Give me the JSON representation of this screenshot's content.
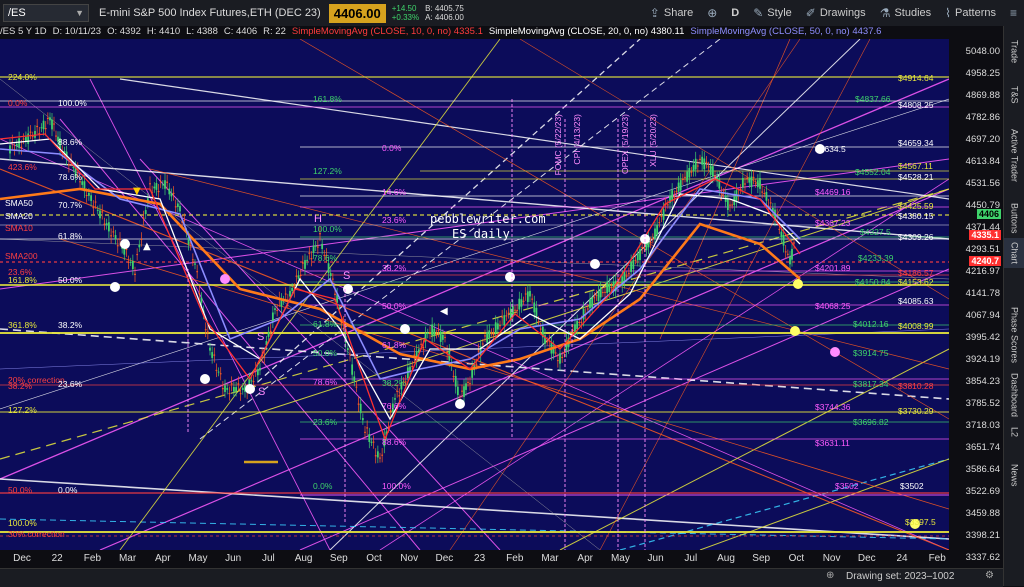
{
  "toolbar": {
    "symbol": "/ES",
    "description": "E-mini S&P 500 Index Futures,ETH (DEC 23)",
    "last_price": "4406.00",
    "change": "+14.50",
    "change_pct": "+0.33%",
    "bid": "B: 4405.75",
    "ask": "A: 4406.00",
    "share_label": "Share",
    "period_label": "D",
    "style_label": "Style",
    "drawings_label": "Drawings",
    "studies_label": "Studies",
    "patterns_label": "Patterns"
  },
  "infobar": {
    "head": "/ES 5 Y 1D",
    "date": "D: 10/11/23",
    "open": "O: 4392",
    "high": "H: 4410",
    "low": "L: 4388",
    "close": "C: 4406",
    "range": "R: 22",
    "sma10": "SimpleMovingAvg (CLOSE, 10, 0, no) 4335.1",
    "sma20": "SimpleMovingAvg (CLOSE, 20, 0, no) 4380.11",
    "sma50": "SimpleMovingAvg (CLOSE, 50, 0, no) 4437.6"
  },
  "colors": {
    "background": "#0c0c5a",
    "up_candle": "#3fd36b",
    "down_candle": "#ff5b1f",
    "sma10": "#ff3030",
    "sma20": "#ffffff",
    "sma50": "#8c8cff",
    "sma200": "#ff7a1a",
    "fib_yellow": "#e8e83c",
    "fib_green": "#3fd36b",
    "fib_magenta": "#ff5cff",
    "accent": "#d6a21e"
  },
  "y_axis": {
    "ticks": [
      "5048.00",
      "4958.25",
      "4869.88",
      "4782.86",
      "4697.20",
      "4613.84",
      "4531.56",
      "4450.79",
      "4371.44",
      "4293.51",
      "4216.97",
      "4141.78",
      "4067.94",
      "3995.42",
      "3924.19",
      "3854.23",
      "3785.52",
      "3718.03",
      "3651.74",
      "3586.64",
      "3522.69",
      "3459.88",
      "3398.21",
      "3337.62"
    ],
    "last_price_tag": "4406",
    "sma10_tag": "4335.1",
    "sma_tag": "4240.7"
  },
  "x_axis": {
    "labels": [
      "Dec",
      "22",
      "Feb",
      "Mar",
      "Apr",
      "May",
      "Jun",
      "Jul",
      "Aug",
      "Sep",
      "Oct",
      "Nov",
      "Dec",
      "23",
      "Feb",
      "Mar",
      "Apr",
      "May",
      "Jun",
      "Jul",
      "Aug",
      "Sep",
      "Oct",
      "Nov",
      "Dec",
      "24",
      "Feb"
    ]
  },
  "chart_labels": {
    "watermark_1": "pebblewriter.com",
    "watermark_2": "ES daily",
    "left_fibs": [
      {
        "t": "224.0%",
        "c": "yellow"
      },
      {
        "t": "0.0%",
        "c": "red"
      },
      {
        "t": "100.0%",
        "c": "white"
      },
      {
        "t": "88.6%",
        "c": "white"
      },
      {
        "t": "423.6%",
        "c": "red"
      },
      {
        "t": "78.6%",
        "c": "white"
      },
      {
        "t": "SMA50",
        "c": "white"
      },
      {
        "t": "70.7%",
        "c": "white"
      },
      {
        "t": "SMA20",
        "c": "white"
      },
      {
        "t": "SMA10",
        "c": "red"
      },
      {
        "t": "61.8%",
        "c": "white"
      },
      {
        "t": "SMA200",
        "c": "red"
      },
      {
        "t": "23.6%",
        "c": "red"
      },
      {
        "t": "161.8%",
        "c": "yellow"
      },
      {
        "t": "50.0%",
        "c": "white"
      },
      {
        "t": "361.8%",
        "c": "yellow"
      },
      {
        "t": "38.2%",
        "c": "white"
      },
      {
        "t": "20% correction",
        "c": "red"
      },
      {
        "t": "38.2%",
        "c": "red"
      },
      {
        "t": "23.6%",
        "c": "white"
      },
      {
        "t": "127.2%",
        "c": "yellow"
      },
      {
        "t": "50.0%",
        "c": "red"
      },
      {
        "t": "0.0%",
        "c": "white"
      },
      {
        "t": "100.0%",
        "c": "yellow"
      },
      {
        "t": "30% correction",
        "c": "red"
      }
    ],
    "mid_fibs": [
      {
        "t": "161.8%",
        "c": "green"
      },
      {
        "t": "0.0%",
        "c": "magenta"
      },
      {
        "t": "127.2%",
        "c": "green"
      },
      {
        "t": "14.6%",
        "c": "magenta"
      },
      {
        "t": "23.6%",
        "c": "magenta"
      },
      {
        "t": "100.0%",
        "c": "green"
      },
      {
        "t": "38.2%",
        "c": "magenta"
      },
      {
        "t": "78.6%",
        "c": "green"
      },
      {
        "t": "61.8%",
        "c": "green"
      },
      {
        "t": "50.0%",
        "c": "magenta"
      },
      {
        "t": "61.8%",
        "c": "magenta"
      },
      {
        "t": "50.0%",
        "c": "green"
      },
      {
        "t": "78.6%",
        "c": "magenta"
      },
      {
        "t": "38.2%",
        "c": "green"
      },
      {
        "t": "76.6%",
        "c": "magenta"
      },
      {
        "t": "23.6%",
        "c": "green"
      },
      {
        "t": "88.6%",
        "c": "magenta"
      },
      {
        "t": "0.0%",
        "c": "green"
      },
      {
        "t": "100.0%",
        "c": "magenta"
      }
    ],
    "right_levels": [
      {
        "t": "$4914.64",
        "c": "yellow"
      },
      {
        "t": "$4837.66",
        "c": "green"
      },
      {
        "t": "$4808.25",
        "c": "white"
      },
      {
        "t": "$4659.34",
        "c": "white"
      },
      {
        "t": "$4634.5",
        "c": "white"
      },
      {
        "t": "$4567.11",
        "c": "yellow"
      },
      {
        "t": "$4552.04",
        "c": "green"
      },
      {
        "t": "$4528.21",
        "c": "white"
      },
      {
        "t": "$4469.16",
        "c": "magenta"
      },
      {
        "t": "$4425.59",
        "c": "yellow"
      },
      {
        "t": "$4380.15",
        "c": "white"
      },
      {
        "t": "$4367.23",
        "c": "magenta"
      },
      {
        "t": "$4327.5",
        "c": "green"
      },
      {
        "t": "$4309.26",
        "c": "white"
      },
      {
        "t": "$4233.39",
        "c": "green"
      },
      {
        "t": "$4201.89",
        "c": "magenta"
      },
      {
        "t": "$4186.57",
        "c": "red"
      },
      {
        "t": "$4153.62",
        "c": "yellow"
      },
      {
        "t": "$4150.84",
        "c": "green"
      },
      {
        "t": "$4085.63",
        "c": "white"
      },
      {
        "t": "$4068.25",
        "c": "magenta"
      },
      {
        "t": "$4012.16",
        "c": "green"
      },
      {
        "t": "$4008.99",
        "c": "yellow"
      },
      {
        "t": "$3914.75",
        "c": "green"
      },
      {
        "t": "$3817.34",
        "c": "green"
      },
      {
        "t": "$3810.28",
        "c": "red"
      },
      {
        "t": "$3744.36",
        "c": "magenta"
      },
      {
        "t": "$3730.29",
        "c": "yellow"
      },
      {
        "t": "$3696.82",
        "c": "green"
      },
      {
        "t": "$3631.11",
        "c": "magenta"
      },
      {
        "t": "$3502",
        "c": "magenta"
      },
      {
        "t": "$3502",
        "c": "white"
      },
      {
        "t": "$3397.5",
        "c": "yellow"
      }
    ],
    "event_labels": [
      "FOMC (5/22/23)",
      "CPI (4/13/23)",
      "OPEX (5/19/23)",
      "XLU (5/20/23)"
    ],
    "wave_labels": [
      "H",
      "S",
      "S",
      "S"
    ]
  },
  "right_tabs": [
    "Trade",
    "T&S",
    "Active Trader",
    "Buttons",
    "Chart",
    "Phase Scores",
    "Dashboard",
    "L2",
    "News"
  ],
  "bottom": {
    "drawing_set": "Drawing set: 2023–1002"
  }
}
